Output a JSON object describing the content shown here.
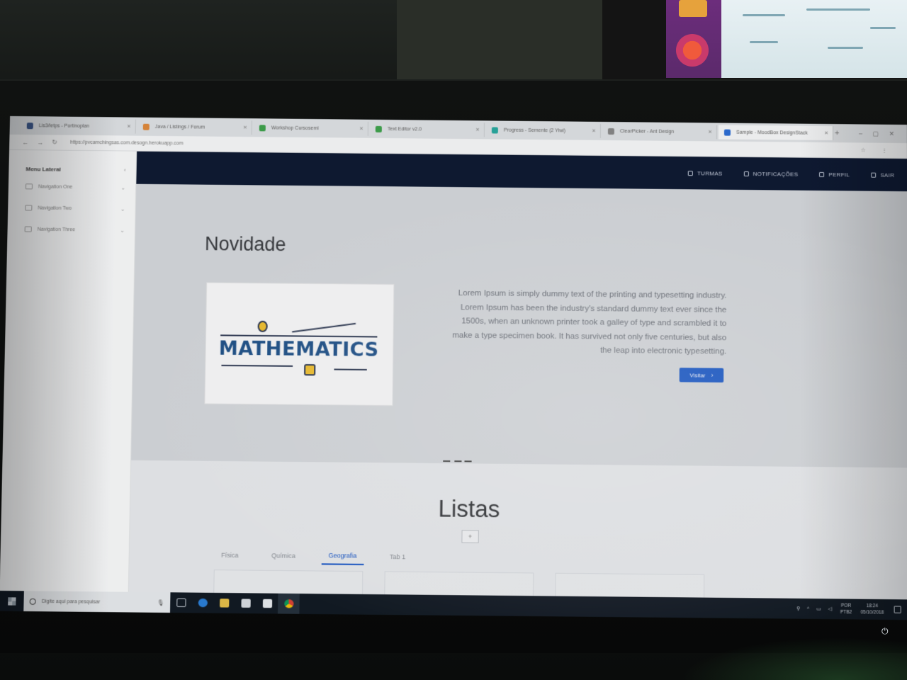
{
  "browser": {
    "tabs": [
      {
        "label": "Lis3/letps - Portinoplan",
        "favicon_color": "#3d5a8c"
      },
      {
        "label": "Java / Listings / Forum",
        "favicon_color": "#e08a3c"
      },
      {
        "label": "Workshop Cursosemi",
        "favicon_color": "#3fa34d"
      },
      {
        "label": "Text Editor v2.0",
        "favicon_color": "#3fa34d"
      },
      {
        "label": "Progress - Semente (2 Yiwi)",
        "favicon_color": "#2aa9a0"
      },
      {
        "label": "ClearPicker - Ant Design",
        "favicon_color": "#888888"
      },
      {
        "label": "Sample - MoodBox DesignStack",
        "favicon_color": "#2d6fd6"
      }
    ],
    "url": "https://pvcamchingsas.com.desogn.herokuapp.com"
  },
  "sidemenu": {
    "title": "Menu Lateral",
    "items": [
      {
        "label": "Navigation One"
      },
      {
        "label": "Navigation Two"
      },
      {
        "label": "Navigation Three"
      }
    ]
  },
  "appbar": {
    "nav": [
      {
        "label": "TURMAS"
      },
      {
        "label": "NOTIFICAÇÕES"
      },
      {
        "label": "PERFIL"
      },
      {
        "label": "SAIR"
      }
    ]
  },
  "novidade": {
    "title": "Novidade",
    "image_word": "MATHEMATICS",
    "text": "Lorem Ipsum is simply dummy text of the printing and typesetting industry. Lorem Ipsum has been the industry's standard dummy text ever since the 1500s, when an unknown printer took a galley of type and scrambled it to make a type specimen book. It has survived not only five centuries, but also the leap into electronic typesetting.",
    "button": "Visitar"
  },
  "listas": {
    "title": "Listas",
    "add_label": "+",
    "tabs": [
      {
        "label": "Física",
        "active": false
      },
      {
        "label": "Química",
        "active": false
      },
      {
        "label": "Geografia",
        "active": true
      },
      {
        "label": "Tab 1",
        "active": false
      }
    ]
  },
  "taskbar": {
    "search_placeholder": "Digite aqui para pesquisar",
    "tray_lang": "POR",
    "tray_layout": "PTB2",
    "time": "18:24",
    "date": "05/10/2018"
  },
  "colors": {
    "appbar": "#0f1a33",
    "primary": "#1857c8",
    "math_text": "#1c4f88"
  }
}
